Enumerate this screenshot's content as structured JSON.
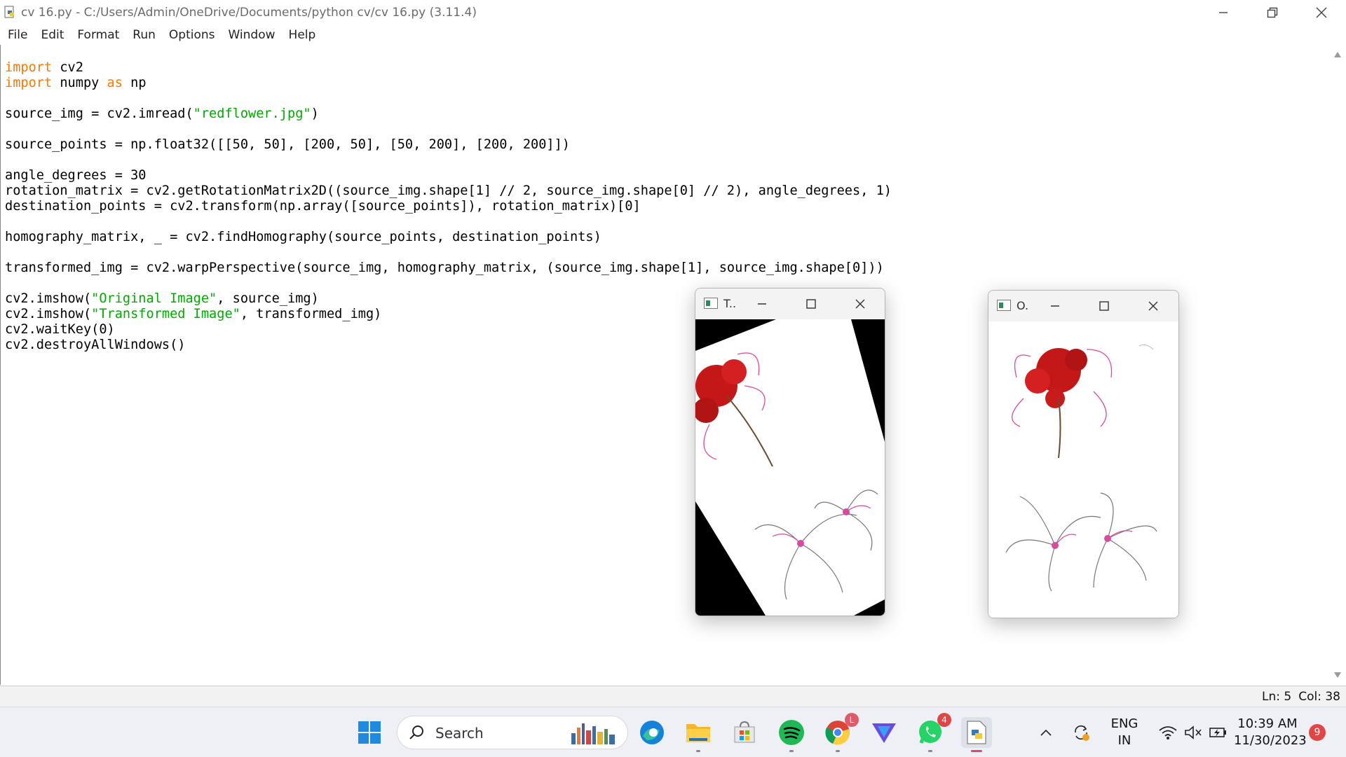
{
  "window": {
    "title": "cv 16.py - C:/Users/Admin/OneDrive/Documents/python cv/cv 16.py (3.11.4)"
  },
  "menu": [
    "File",
    "Edit",
    "Format",
    "Run",
    "Options",
    "Window",
    "Help"
  ],
  "code": {
    "kw_import": "import",
    "kw_as": "as",
    "line1_rest": " cv2",
    "line2_mid": " numpy ",
    "line2_end": " np",
    "line4_a": "source_img = cv2.imread(",
    "line4_str": "\"redflower.jpg\"",
    "line4_b": ")",
    "line6": "source_points = np.float32([[50, 50], [200, 50], [50, 200], [200, 200]])",
    "line8": "angle_degrees = 30",
    "line9": "rotation_matrix = cv2.getRotationMatrix2D((source_img.shape[1] // 2, source_img.shape[0] // 2), angle_degrees, 1)",
    "line10": "destination_points = cv2.transform(np.array([source_points]), rotation_matrix)[0]",
    "line12": "homography_matrix, _ = cv2.findHomography(source_points, destination_points)",
    "line14": "transformed_img = cv2.warpPerspective(source_img, homography_matrix, (source_img.shape[1], source_img.shape[0]))",
    "line16_a": "cv2.imshow(",
    "line16_str": "\"Original Image\"",
    "line16_b": ", source_img)",
    "line17_a": "cv2.imshow(",
    "line17_str": "\"Transformed Image\"",
    "line17_b": ", transformed_img)",
    "line18": "cv2.waitKey(0)",
    "line19": "cv2.destroyAllWindows()"
  },
  "statusbar": {
    "line": "Ln: 5",
    "col": "Col: 38"
  },
  "windows": {
    "transformed_title": "T..",
    "original_title": "O."
  },
  "taskbar": {
    "search_label": "Search",
    "chrome_badge": "L",
    "whatsapp_badge": "4",
    "lang_top": "ENG",
    "lang_bottom": "IN",
    "time": "10:39 AM",
    "date": "11/30/2023",
    "notif_count": "9"
  },
  "colors": {
    "keyword": "#ff7700",
    "string": "#00aa00",
    "flower_red": "#cc1a1a",
    "flower_pink": "#d84aa0"
  },
  "icons": [
    "python-file-icon",
    "minimize-icon",
    "restore-icon",
    "close-icon",
    "windows-start-icon",
    "search-icon",
    "edge-icon",
    "file-explorer-icon",
    "microsoft-store-icon",
    "spotify-icon",
    "chrome-icon",
    "vpn-icon",
    "whatsapp-icon",
    "idle-icon",
    "chevron-up-icon",
    "sync-icon",
    "wifi-icon",
    "mute-icon",
    "battery-icon"
  ]
}
